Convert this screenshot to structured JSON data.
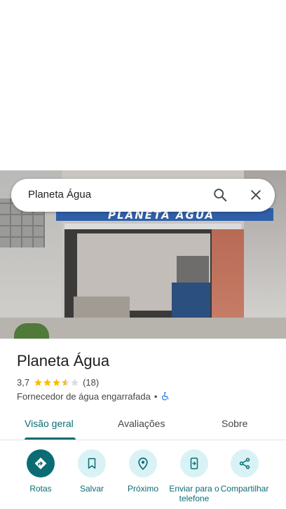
{
  "search": {
    "query": "Planeta Água"
  },
  "hero": {
    "sign_text": "PLANETA ÁGUA"
  },
  "place": {
    "title": "Planeta Água",
    "rating": "3,7",
    "rating_value": 3.7,
    "review_count": "(18)",
    "category": "Fornecedor de água engarrafada",
    "separator": "•"
  },
  "tabs": [
    {
      "label": "Visão geral",
      "active": true
    },
    {
      "label": "Avaliações",
      "active": false
    },
    {
      "label": "Sobre",
      "active": false
    }
  ],
  "actions": [
    {
      "label": "Rotas",
      "icon": "directions-icon"
    },
    {
      "label": "Salvar",
      "icon": "bookmark-icon"
    },
    {
      "label": "Próximo",
      "icon": "nearby-icon"
    },
    {
      "label": "Enviar para o telefone",
      "icon": "send-to-phone-icon"
    },
    {
      "label": "Compartilhar",
      "icon": "share-icon"
    }
  ],
  "colors": {
    "accent": "#0b6d73",
    "action_bg": "#d9f2f5",
    "star": "#fbbc04",
    "accessible": "#1a73e8"
  }
}
